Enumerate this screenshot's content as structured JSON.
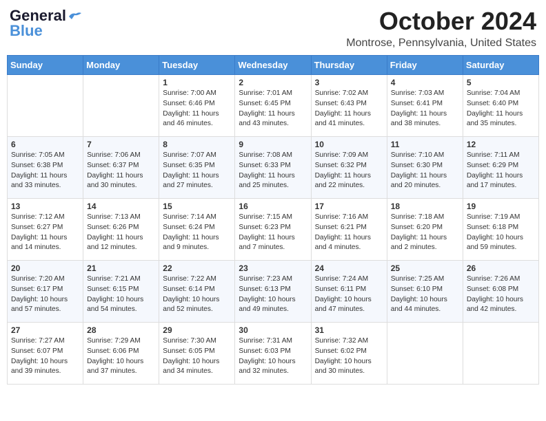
{
  "header": {
    "logo_general": "General",
    "logo_blue": "Blue",
    "main_title": "October 2024",
    "subtitle": "Montrose, Pennsylvania, United States"
  },
  "weekdays": [
    "Sunday",
    "Monday",
    "Tuesday",
    "Wednesday",
    "Thursday",
    "Friday",
    "Saturday"
  ],
  "weeks": [
    [
      {
        "day": "",
        "info": ""
      },
      {
        "day": "",
        "info": ""
      },
      {
        "day": "1",
        "info": "Sunrise: 7:00 AM\nSunset: 6:46 PM\nDaylight: 11 hours and 46 minutes."
      },
      {
        "day": "2",
        "info": "Sunrise: 7:01 AM\nSunset: 6:45 PM\nDaylight: 11 hours and 43 minutes."
      },
      {
        "day": "3",
        "info": "Sunrise: 7:02 AM\nSunset: 6:43 PM\nDaylight: 11 hours and 41 minutes."
      },
      {
        "day": "4",
        "info": "Sunrise: 7:03 AM\nSunset: 6:41 PM\nDaylight: 11 hours and 38 minutes."
      },
      {
        "day": "5",
        "info": "Sunrise: 7:04 AM\nSunset: 6:40 PM\nDaylight: 11 hours and 35 minutes."
      }
    ],
    [
      {
        "day": "6",
        "info": "Sunrise: 7:05 AM\nSunset: 6:38 PM\nDaylight: 11 hours and 33 minutes."
      },
      {
        "day": "7",
        "info": "Sunrise: 7:06 AM\nSunset: 6:37 PM\nDaylight: 11 hours and 30 minutes."
      },
      {
        "day": "8",
        "info": "Sunrise: 7:07 AM\nSunset: 6:35 PM\nDaylight: 11 hours and 27 minutes."
      },
      {
        "day": "9",
        "info": "Sunrise: 7:08 AM\nSunset: 6:33 PM\nDaylight: 11 hours and 25 minutes."
      },
      {
        "day": "10",
        "info": "Sunrise: 7:09 AM\nSunset: 6:32 PM\nDaylight: 11 hours and 22 minutes."
      },
      {
        "day": "11",
        "info": "Sunrise: 7:10 AM\nSunset: 6:30 PM\nDaylight: 11 hours and 20 minutes."
      },
      {
        "day": "12",
        "info": "Sunrise: 7:11 AM\nSunset: 6:29 PM\nDaylight: 11 hours and 17 minutes."
      }
    ],
    [
      {
        "day": "13",
        "info": "Sunrise: 7:12 AM\nSunset: 6:27 PM\nDaylight: 11 hours and 14 minutes."
      },
      {
        "day": "14",
        "info": "Sunrise: 7:13 AM\nSunset: 6:26 PM\nDaylight: 11 hours and 12 minutes."
      },
      {
        "day": "15",
        "info": "Sunrise: 7:14 AM\nSunset: 6:24 PM\nDaylight: 11 hours and 9 minutes."
      },
      {
        "day": "16",
        "info": "Sunrise: 7:15 AM\nSunset: 6:23 PM\nDaylight: 11 hours and 7 minutes."
      },
      {
        "day": "17",
        "info": "Sunrise: 7:16 AM\nSunset: 6:21 PM\nDaylight: 11 hours and 4 minutes."
      },
      {
        "day": "18",
        "info": "Sunrise: 7:18 AM\nSunset: 6:20 PM\nDaylight: 11 hours and 2 minutes."
      },
      {
        "day": "19",
        "info": "Sunrise: 7:19 AM\nSunset: 6:18 PM\nDaylight: 10 hours and 59 minutes."
      }
    ],
    [
      {
        "day": "20",
        "info": "Sunrise: 7:20 AM\nSunset: 6:17 PM\nDaylight: 10 hours and 57 minutes."
      },
      {
        "day": "21",
        "info": "Sunrise: 7:21 AM\nSunset: 6:15 PM\nDaylight: 10 hours and 54 minutes."
      },
      {
        "day": "22",
        "info": "Sunrise: 7:22 AM\nSunset: 6:14 PM\nDaylight: 10 hours and 52 minutes."
      },
      {
        "day": "23",
        "info": "Sunrise: 7:23 AM\nSunset: 6:13 PM\nDaylight: 10 hours and 49 minutes."
      },
      {
        "day": "24",
        "info": "Sunrise: 7:24 AM\nSunset: 6:11 PM\nDaylight: 10 hours and 47 minutes."
      },
      {
        "day": "25",
        "info": "Sunrise: 7:25 AM\nSunset: 6:10 PM\nDaylight: 10 hours and 44 minutes."
      },
      {
        "day": "26",
        "info": "Sunrise: 7:26 AM\nSunset: 6:08 PM\nDaylight: 10 hours and 42 minutes."
      }
    ],
    [
      {
        "day": "27",
        "info": "Sunrise: 7:27 AM\nSunset: 6:07 PM\nDaylight: 10 hours and 39 minutes."
      },
      {
        "day": "28",
        "info": "Sunrise: 7:29 AM\nSunset: 6:06 PM\nDaylight: 10 hours and 37 minutes."
      },
      {
        "day": "29",
        "info": "Sunrise: 7:30 AM\nSunset: 6:05 PM\nDaylight: 10 hours and 34 minutes."
      },
      {
        "day": "30",
        "info": "Sunrise: 7:31 AM\nSunset: 6:03 PM\nDaylight: 10 hours and 32 minutes."
      },
      {
        "day": "31",
        "info": "Sunrise: 7:32 AM\nSunset: 6:02 PM\nDaylight: 10 hours and 30 minutes."
      },
      {
        "day": "",
        "info": ""
      },
      {
        "day": "",
        "info": ""
      }
    ]
  ]
}
